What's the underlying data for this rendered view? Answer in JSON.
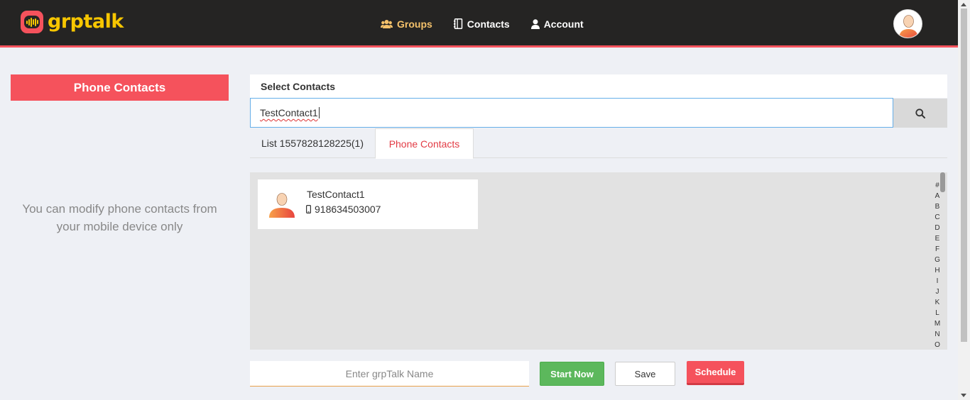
{
  "header": {
    "logo_text": "grptalk",
    "nav": [
      {
        "label": "Groups",
        "icon": "users-icon",
        "active": true
      },
      {
        "label": "Contacts",
        "icon": "address-book-icon",
        "active": false
      },
      {
        "label": "Account",
        "icon": "user-icon",
        "active": false
      }
    ],
    "colors": {
      "bar": "#252423",
      "accent": "#f5525c",
      "logo": "#f7c600",
      "active_nav": "#f5c26b"
    }
  },
  "sidebar": {
    "title": "Phone Contacts",
    "note": "You can modify phone contacts from your mobile device only"
  },
  "main": {
    "heading": "Select Contacts",
    "search_value": "TestContact1",
    "tabs": [
      {
        "label": "List 1557828128225(1)",
        "active": false
      },
      {
        "label": "Phone Contacts",
        "active": true
      }
    ],
    "contacts": [
      {
        "name": "TestContact1",
        "phone": "918634503007"
      }
    ],
    "alpha_index": [
      "#",
      "A",
      "B",
      "C",
      "D",
      "E",
      "F",
      "G",
      "H",
      "I",
      "J",
      "K",
      "L",
      "M",
      "N",
      "O"
    ]
  },
  "footer": {
    "name_placeholder": "Enter grpTalk Name",
    "start_label": "Start Now",
    "save_label": "Save",
    "schedule_label": "Schedule"
  }
}
